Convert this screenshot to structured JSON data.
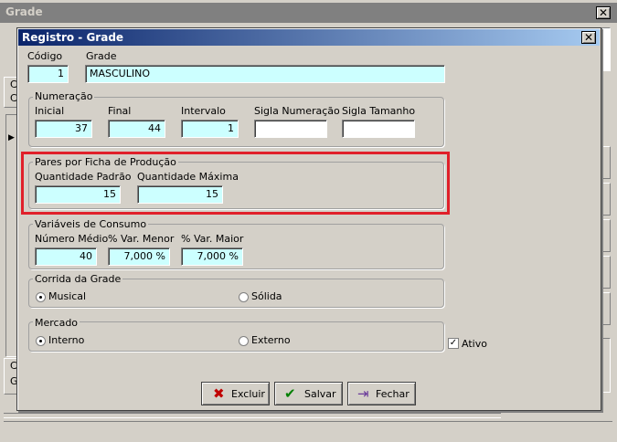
{
  "outer_window": {
    "title": "Grade",
    "close_symbol": "✕",
    "left_labels": [
      "C",
      "C"
    ],
    "left_field_value": "G",
    "left_field2_value": "C",
    "grid_marker": "▶"
  },
  "dialog": {
    "title": "Registro - Grade",
    "close_symbol": "✕",
    "codigo": {
      "label": "Código",
      "value": "1"
    },
    "grade": {
      "label": "Grade",
      "value": "MASCULINO"
    },
    "numeracao": {
      "title": "Numeração",
      "inicial": {
        "label": "Inicial",
        "value": "37"
      },
      "final": {
        "label": "Final",
        "value": "44"
      },
      "intervalo": {
        "label": "Intervalo",
        "value": "1"
      },
      "sigla_numeracao": {
        "label": "Sigla Numeração",
        "value": ""
      },
      "sigla_tamanho": {
        "label": "Sigla Tamanho",
        "value": ""
      }
    },
    "pares": {
      "title": "Pares por Ficha de Produção",
      "quantidade_padrao": {
        "label": "Quantidade Padrão",
        "value": "15"
      },
      "quantidade_maxima": {
        "label": "Quantidade Máxima",
        "value": "15"
      }
    },
    "variaveis": {
      "title": "Variáveis de Consumo",
      "numero_medio": {
        "label": "Número Médio",
        "value": "40"
      },
      "var_menor": {
        "label": "% Var. Menor",
        "value": "7,000 %"
      },
      "var_maior": {
        "label": "% Var. Maior",
        "value": "7,000 %"
      }
    },
    "corrida": {
      "title": "Corrida da Grade",
      "options": [
        "Musical",
        "Sólida"
      ],
      "selected": "Musical"
    },
    "mercado": {
      "title": "Mercado",
      "options": [
        "Interno",
        "Externo"
      ],
      "selected": "Interno"
    },
    "ativo": {
      "label": "Ativo",
      "checked": true,
      "check_symbol": "✓"
    },
    "buttons": {
      "excluir": {
        "label": "Excluir",
        "icon": "x-icon",
        "glyph": "✖",
        "color": "#c00000"
      },
      "salvar": {
        "label": "Salvar",
        "icon": "check-icon",
        "glyph": "✔",
        "color": "#008000"
      },
      "fechar": {
        "label": "Fechar",
        "icon": "door-exit-icon",
        "glyph": "⇥",
        "color": "#6a3a9a"
      }
    }
  },
  "colors": {
    "input_bg": "#ccffff",
    "title_bar_start": "#0a246a",
    "highlight": "#e0202a"
  }
}
